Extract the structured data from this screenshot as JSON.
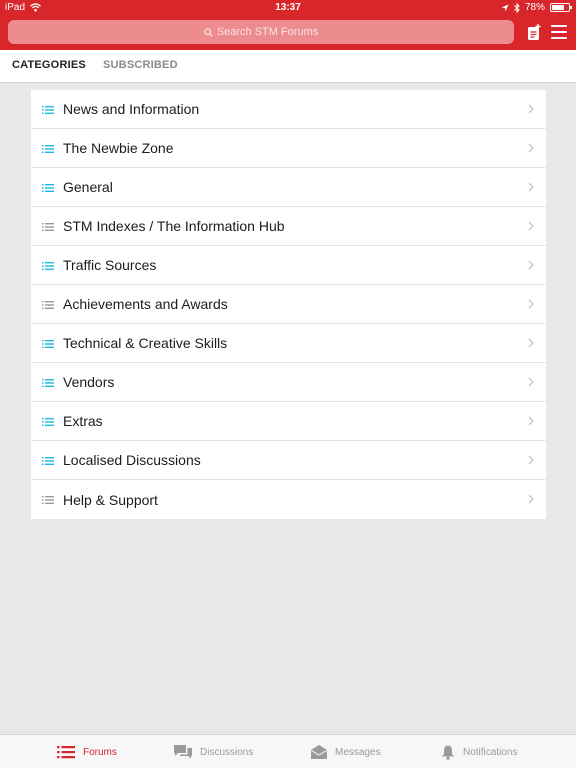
{
  "status": {
    "device": "iPad",
    "time": "13:37",
    "battery": "78%",
    "battery_level": 0.78
  },
  "search": {
    "placeholder": "Search STM Forums"
  },
  "tabs": [
    {
      "label": "CATEGORIES",
      "active": true
    },
    {
      "label": "SUBSCRIBED",
      "active": false
    }
  ],
  "categories": [
    {
      "label": "News and Information",
      "icon": "list-icon",
      "icon_color": "#20b7e3"
    },
    {
      "label": "The Newbie Zone",
      "icon": "list-icon",
      "icon_color": "#20b7e3"
    },
    {
      "label": "General",
      "icon": "list-icon",
      "icon_color": "#20b7e3"
    },
    {
      "label": "STM Indexes / The Information Hub",
      "icon": "list-icon",
      "icon_color": "#9a9a9a"
    },
    {
      "label": "Traffic Sources",
      "icon": "list-icon",
      "icon_color": "#20b7e3"
    },
    {
      "label": "Achievements and Awards",
      "icon": "list-icon",
      "icon_color": "#9a9a9a"
    },
    {
      "label": "Technical & Creative Skills",
      "icon": "list-icon",
      "icon_color": "#20b7e3"
    },
    {
      "label": "Vendors",
      "icon": "list-icon",
      "icon_color": "#20b7e3"
    },
    {
      "label": "Extras",
      "icon": "list-icon",
      "icon_color": "#20b7e3"
    },
    {
      "label": "Localised Discussions",
      "icon": "list-icon",
      "icon_color": "#20b7e3"
    },
    {
      "label": "Help & Support",
      "icon": "list-icon",
      "icon_color": "#9a9a9a"
    }
  ],
  "bottom_tabs": [
    {
      "label": "Forums",
      "icon": "forums-icon",
      "active": true
    },
    {
      "label": "Discussions",
      "icon": "discussions-icon",
      "active": false
    },
    {
      "label": "Messages",
      "icon": "messages-icon",
      "active": false
    },
    {
      "label": "Notifications",
      "icon": "notifications-icon",
      "active": false
    }
  ],
  "colors": {
    "brand": "#d9262a",
    "accent_list": "#20b7e3",
    "muted": "#9a9a9a"
  }
}
